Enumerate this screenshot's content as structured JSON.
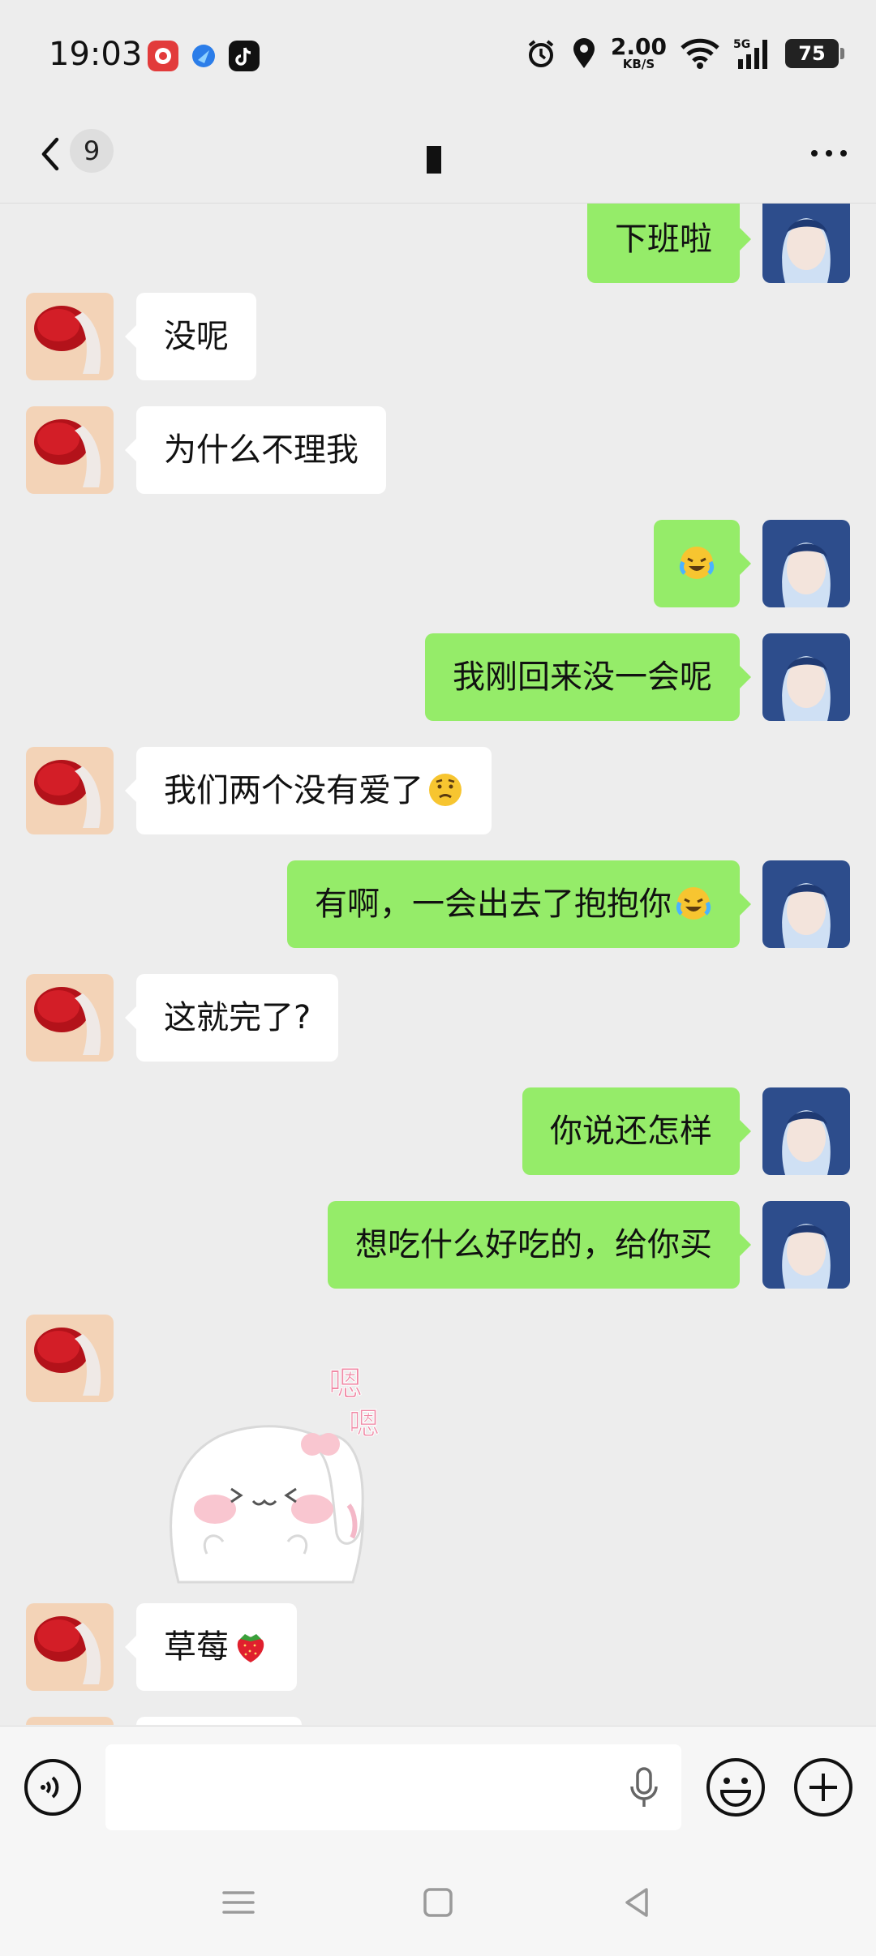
{
  "status_bar": {
    "time": "19:03",
    "net_speed_value": "2.00",
    "net_speed_unit": "KB/S",
    "network_label": "5G",
    "battery": "75"
  },
  "header": {
    "unread_count": "9"
  },
  "messages": [
    {
      "side": "right",
      "text": "下班啦"
    },
    {
      "side": "left",
      "text": "没呢"
    },
    {
      "side": "left",
      "text": "为什么不理我"
    },
    {
      "side": "right",
      "text": "",
      "emoji": "laughing-crying-emoji"
    },
    {
      "side": "right",
      "text": "我刚回来没一会呢"
    },
    {
      "side": "left",
      "text": "我们两个没有爱了",
      "emoji": "confused-emoji"
    },
    {
      "side": "right",
      "text": "有啊，一会出去了抱抱你",
      "emoji": "laughing-crying-emoji"
    },
    {
      "side": "left",
      "text": "这就完了?"
    },
    {
      "side": "right",
      "text": "你说还怎样"
    },
    {
      "side": "right",
      "text": "想吃什么好吃的，给你买"
    },
    {
      "side": "left",
      "type": "sticker",
      "sticker_text_1": "嗯",
      "sticker_text_2": "嗯"
    },
    {
      "side": "left",
      "text": "草莓",
      "emoji": "strawberry-emoji"
    }
  ],
  "colors": {
    "background": "#ededed",
    "bubble_self": "#95ec69",
    "bubble_other": "#ffffff"
  }
}
